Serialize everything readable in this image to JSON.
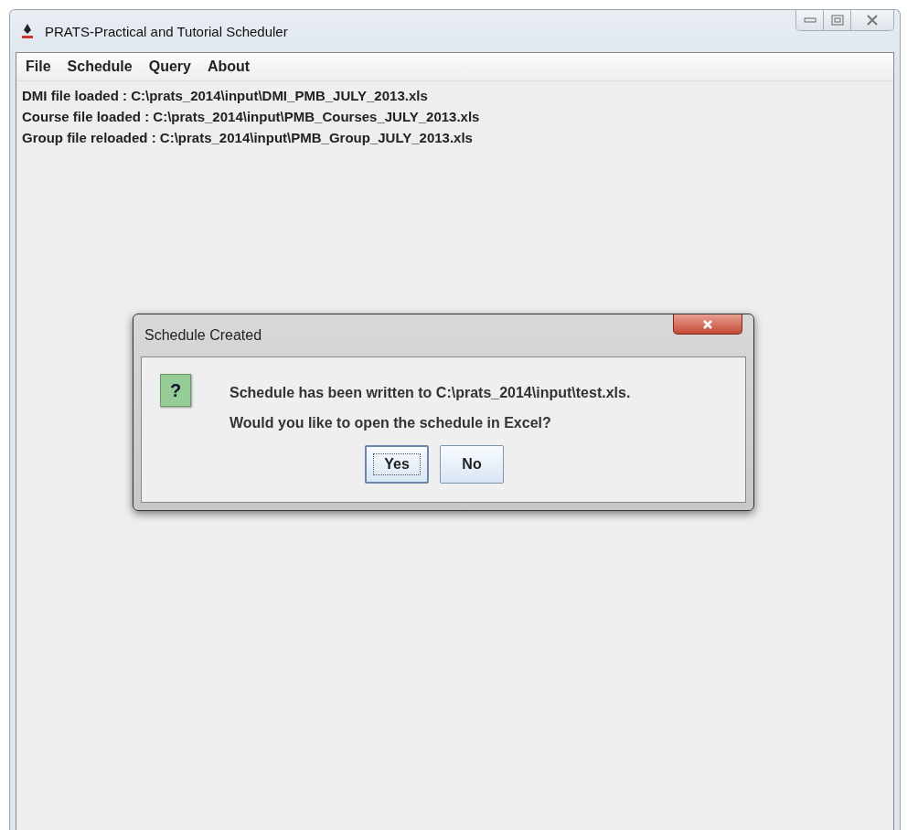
{
  "window": {
    "title": "PRATS-Practical and Tutorial Scheduler"
  },
  "menu": [
    "File",
    "Schedule",
    "Query",
    "About"
  ],
  "log_lines": [
    "DMI file loaded : C:\\prats_2014\\input\\DMI_PMB_JULY_2013.xls",
    "Course file loaded : C:\\prats_2014\\input\\PMB_Courses_JULY_2013.xls",
    "Group file reloaded : C:\\prats_2014\\input\\PMB_Group_JULY_2013.xls"
  ],
  "dialog": {
    "title": "Schedule Created",
    "icon_glyph": "?",
    "message_lines": [
      "Schedule has been written to C:\\prats_2014\\input\\test.xls.",
      "Would you like to open the schedule in Excel?"
    ],
    "buttons": [
      {
        "label": "Yes",
        "focused": true
      },
      {
        "label": "No",
        "focused": false
      }
    ]
  }
}
